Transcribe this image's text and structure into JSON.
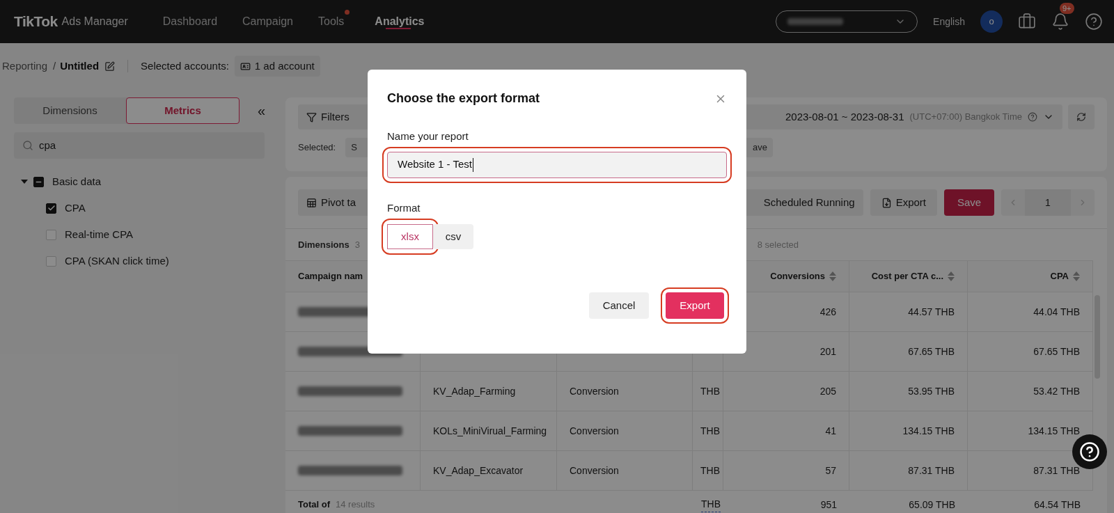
{
  "top_bar": {
    "logo": "TikTok",
    "product": "Ads Manager",
    "nav": [
      {
        "label": "Dashboard",
        "selected": false,
        "dot": false
      },
      {
        "label": "Campaign",
        "selected": false,
        "dot": false
      },
      {
        "label": "Tools",
        "selected": false,
        "dot": true
      },
      {
        "label": "Analytics",
        "selected": true,
        "dot": false
      }
    ],
    "language": "English",
    "avatar": "o",
    "notifications_badge": "9+"
  },
  "breadcrumb": {
    "parent": "Reporting",
    "separator": "/",
    "current": "Untitled",
    "accounts_label": "Selected accounts:",
    "accounts_chip": "1 ad account"
  },
  "side_panel": {
    "tabs": [
      {
        "label": "Dimensions",
        "selected": false
      },
      {
        "label": "Metrics",
        "selected": true
      }
    ],
    "collapse": "«",
    "search": {
      "value": "cpa"
    },
    "tree": [
      {
        "label": "Basic data",
        "expanded": true,
        "indeterminate": true,
        "children": [
          {
            "label": "CPA",
            "checked": true
          },
          {
            "label": "Real-time CPA",
            "checked": false
          },
          {
            "label": "CPA (SKAN click time)",
            "checked": false
          }
        ]
      }
    ]
  },
  "filters": {
    "button": "Filters",
    "date_range": "2023-08-01 ~ 2023-08-31",
    "timezone": "(UTC+07:00) Bangkok Time",
    "selected_label": "Selected:",
    "selected_chips": [
      "S",
      "ave"
    ]
  },
  "toolbar": {
    "pivot": "Pivot ta",
    "scheduled": "Scheduled Running",
    "export": "Export",
    "save": "Save",
    "page": "1"
  },
  "summary": {
    "dimensions_label": "Dimensions",
    "dimensions_count": "3",
    "metrics_selected": "8 selected"
  },
  "table": {
    "columns": [
      "Campaign nam",
      "",
      "",
      "",
      "Conversions",
      "Cost per CTA c...",
      "CPA"
    ],
    "rows": [
      {
        "cells": [
          "",
          "",
          "",
          "",
          "426",
          "44.57 THB",
          "44.04 THB"
        ]
      },
      {
        "cells": [
          "",
          "",
          "",
          "",
          "201",
          "67.65 THB",
          "67.65 THB"
        ]
      },
      {
        "cells": [
          "",
          "KV_Adap_Farming",
          "Conversion",
          "THB",
          "205",
          "53.95 THB",
          "53.42 THB"
        ]
      },
      {
        "cells": [
          "",
          "KOLs_MiniVirual_Farming",
          "Conversion",
          "THB",
          "41",
          "134.15 THB",
          "134.15 THB"
        ]
      },
      {
        "cells": [
          "",
          "KV_Adap_Excavator",
          "Conversion",
          "THB",
          "57",
          "87.31 THB",
          "87.31 THB"
        ]
      }
    ],
    "total": {
      "label": "Total of",
      "count": "14 results",
      "cells": [
        "THB",
        "951",
        "65.09 THB",
        "64.54 THB"
      ]
    }
  },
  "dialog": {
    "title": "Choose the export format",
    "name_label": "Name your report",
    "name_value": "Website 1 - Test",
    "name_highlighted": true,
    "format_label": "Format",
    "formats": [
      {
        "label": "xlsx",
        "selected": true,
        "highlighted": true
      },
      {
        "label": "csv",
        "selected": false,
        "highlighted": false
      }
    ],
    "cancel": "Cancel",
    "confirm": "Export",
    "confirm_highlighted": true
  }
}
